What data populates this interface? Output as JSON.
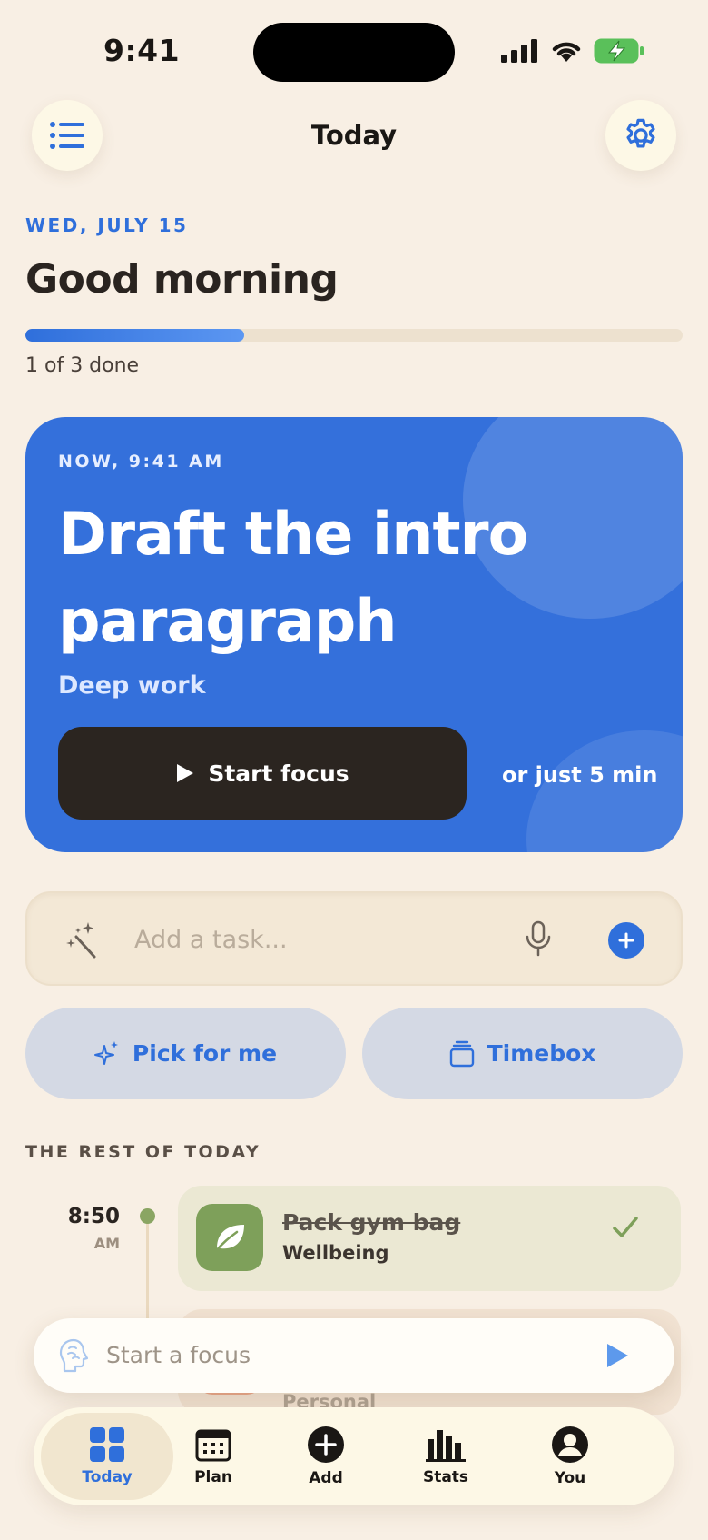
{
  "status_bar": {
    "time": "9:41"
  },
  "header": {
    "title": "Today"
  },
  "summary": {
    "date": "WED, JULY 15",
    "greeting": "Good morning",
    "progress_text": "1 of 3 done",
    "progress_fraction": 0.333
  },
  "hero": {
    "time_label": "NOW, 9:41 AM",
    "title": "Draft the intro paragraph",
    "category": "Deep work",
    "start_label": "Start focus",
    "short_option": "or just 5 min"
  },
  "add_task": {
    "placeholder": "Add a task..."
  },
  "actions": {
    "pick_label": "Pick for me",
    "timebox_label": "Timebox"
  },
  "rest": {
    "label": "THE REST OF TODAY",
    "tasks": [
      {
        "time": "8:50",
        "ampm": "AM",
        "name": "Pack gym bag",
        "category": "Wellbeing",
        "done": true,
        "color": "#7ea05a"
      },
      {
        "category": "Personal",
        "color": "#e8a58a"
      }
    ]
  },
  "focus_bar": {
    "placeholder": "Start a focus"
  },
  "tabs": [
    {
      "label": "Today",
      "icon": "grid-icon",
      "active": true
    },
    {
      "label": "Plan",
      "icon": "calendar-icon"
    },
    {
      "label": "Add",
      "icon": "plus-circle-icon"
    },
    {
      "label": "Stats",
      "icon": "bar-chart-icon"
    },
    {
      "label": "You",
      "icon": "user-icon"
    }
  ],
  "colors": {
    "accent": "#2f6fdb",
    "background": "#f8efe4",
    "hero": "#3470db",
    "success": "#7ea05a"
  }
}
